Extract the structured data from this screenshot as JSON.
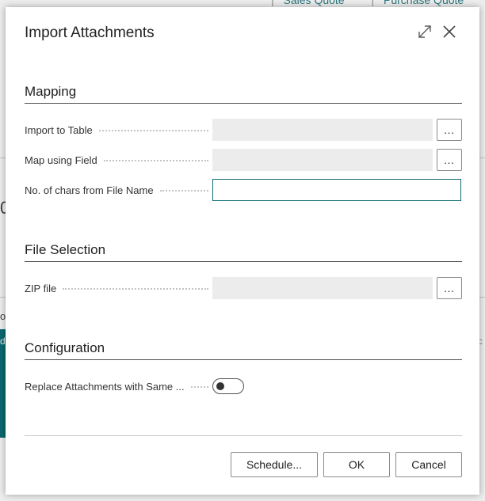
{
  "background": {
    "top_links": [
      "Sales Quote",
      "Purchase Quote"
    ],
    "link_separator": "|",
    "fragments": [
      "0",
      "oi",
      "d",
      "c"
    ]
  },
  "dialog": {
    "title": "Import Attachments",
    "expand_icon": "expand-icon",
    "close_icon": "close-icon"
  },
  "sections": {
    "mapping": {
      "title": "Mapping",
      "fields": [
        {
          "label": "Import to Table",
          "value": "",
          "lookup": "…"
        },
        {
          "label": "Map using Field",
          "value": "",
          "lookup": "…"
        },
        {
          "label": "No. of chars from File Name",
          "value": ""
        }
      ]
    },
    "file_selection": {
      "title": "File Selection",
      "fields": [
        {
          "label": "ZIP file",
          "value": "",
          "lookup": "…"
        }
      ]
    },
    "configuration": {
      "title": "Configuration",
      "fields": [
        {
          "label": "Replace Attachments with Same ...",
          "toggle_on": false
        }
      ]
    }
  },
  "buttons": {
    "schedule": "Schedule...",
    "ok": "OK",
    "cancel": "Cancel"
  },
  "colors": {
    "accent": "#0f6c74",
    "field_bg": "#ececec",
    "text": "#212121"
  }
}
